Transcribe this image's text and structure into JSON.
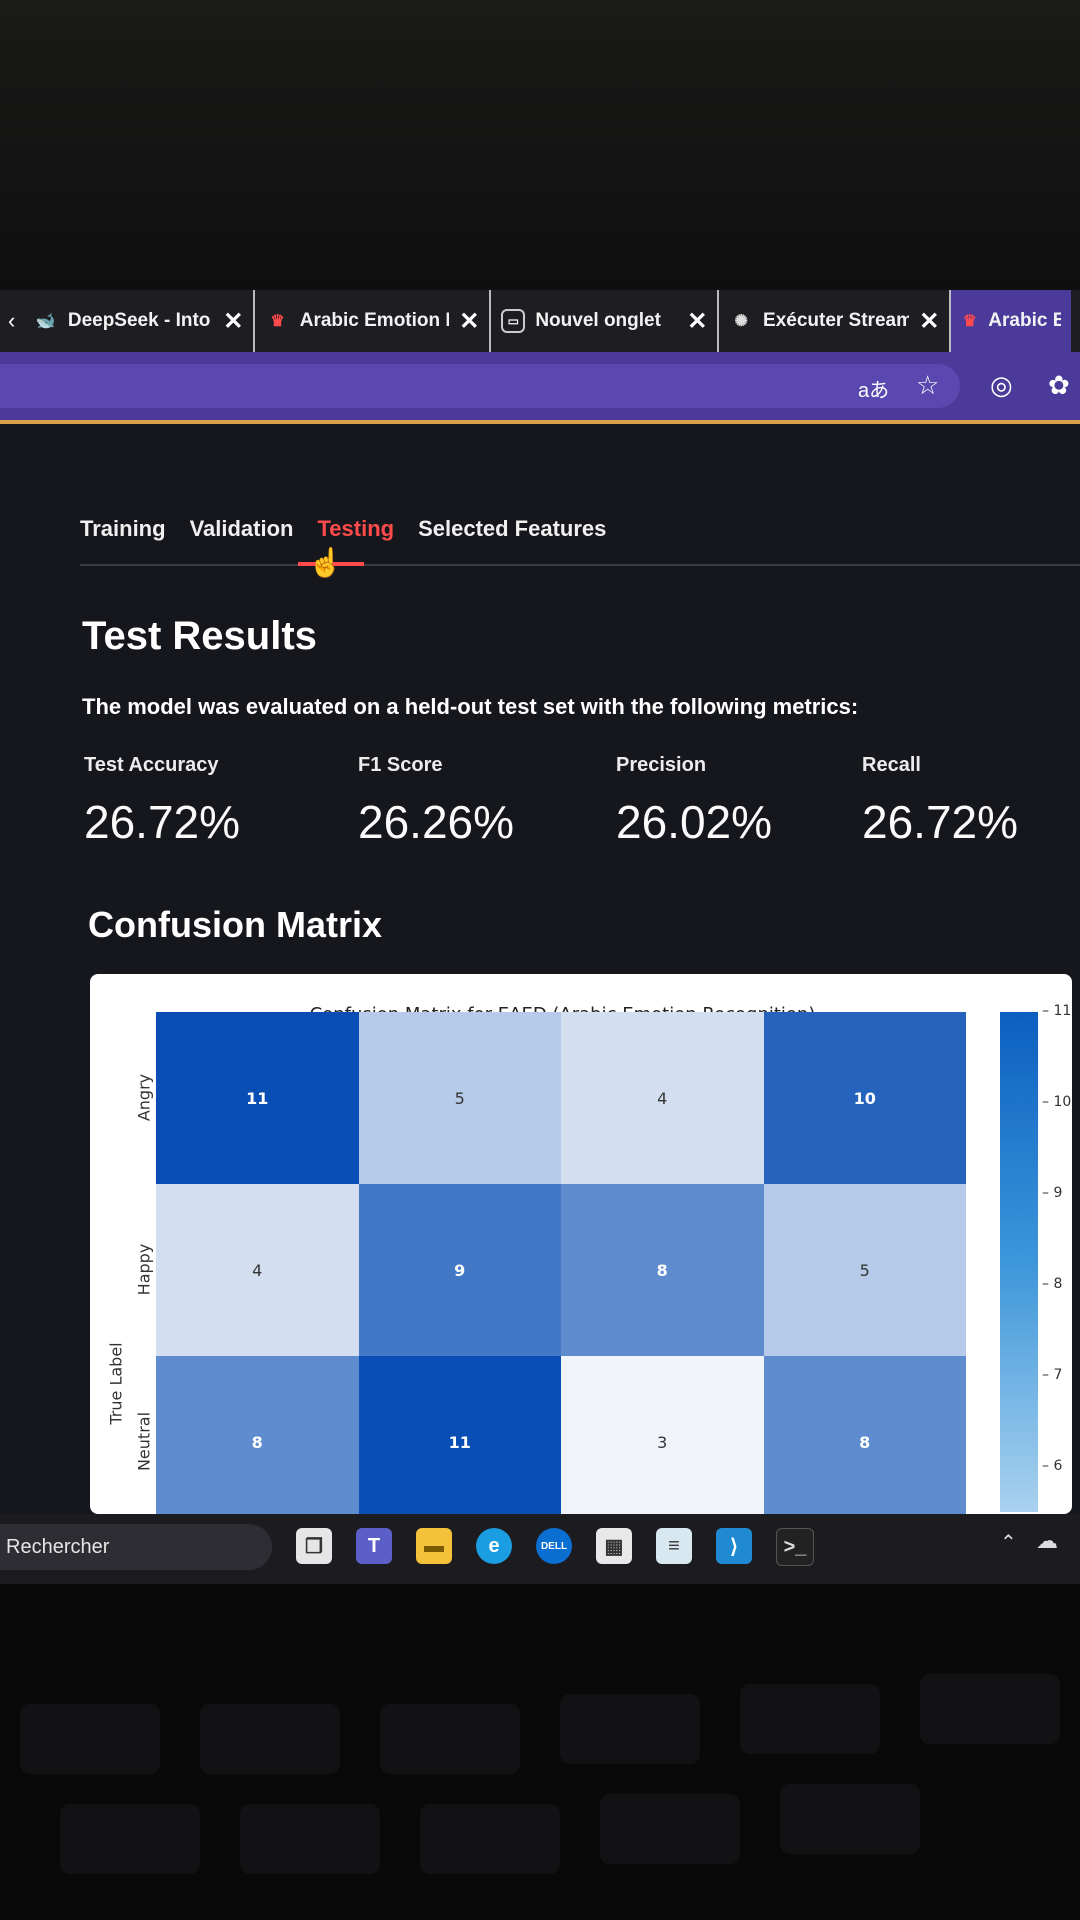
{
  "browser": {
    "tabs": [
      {
        "title": "DeepSeek - Into t",
        "icon": "whale-icon",
        "color": "#4d6bfe"
      },
      {
        "title": "Arabic Emotion R",
        "icon": "streamlit-icon",
        "color": "#ff4b4b"
      },
      {
        "title": "Nouvel onglet",
        "icon": "new-tab-icon",
        "color": "#cccccc"
      },
      {
        "title": "Exécuter Streamli",
        "icon": "chatgpt-icon",
        "color": "#dddddd"
      },
      {
        "title": "Arabic Emot",
        "icon": "streamlit-icon",
        "color": "#ff4b4b"
      }
    ],
    "toolbar_icons": [
      "translate-icon",
      "star-icon",
      "copilot-icon",
      "extensions-icon"
    ],
    "translate_glyph": "aあ",
    "accent": "#4b3a9a"
  },
  "app": {
    "tabs": [
      "Training",
      "Validation",
      "Testing",
      "Selected Features"
    ],
    "active_tab": "Testing",
    "heading": "Test Results",
    "description": "The model was evaluated on a held-out test set with the following metrics:",
    "metrics": [
      {
        "label": "Test Accuracy",
        "value": "26.72%"
      },
      {
        "label": "F1 Score",
        "value": "26.26%"
      },
      {
        "label": "Precision",
        "value": "26.02%"
      },
      {
        "label": "Recall",
        "value": "26.72%"
      }
    ],
    "section_title": "Confusion Matrix"
  },
  "chart_data": {
    "type": "heatmap",
    "title": "Confusion Matrix for EAED (Arabic Emotion Recognition)",
    "ylabel": "True Label",
    "row_labels": [
      "Angry",
      "Happy",
      "Neutral"
    ],
    "matrix": [
      [
        11,
        5,
        4,
        10
      ],
      [
        4,
        9,
        8,
        5
      ],
      [
        8,
        11,
        3,
        8
      ]
    ],
    "colorbar_ticks": [
      6,
      7,
      8,
      9,
      10,
      11
    ],
    "colorbar_range": [
      6,
      11
    ],
    "colormap": "Blues"
  },
  "taskbar": {
    "search_label": "Rechercher",
    "icons": [
      "task-view-icon",
      "teams-icon",
      "file-explorer-icon",
      "edge-icon",
      "dell-icon",
      "store-icon",
      "notepad-icon",
      "vscode-icon",
      "terminal-icon"
    ],
    "tray_icons": [
      "chevron-up-icon",
      "cloud-icon"
    ]
  }
}
